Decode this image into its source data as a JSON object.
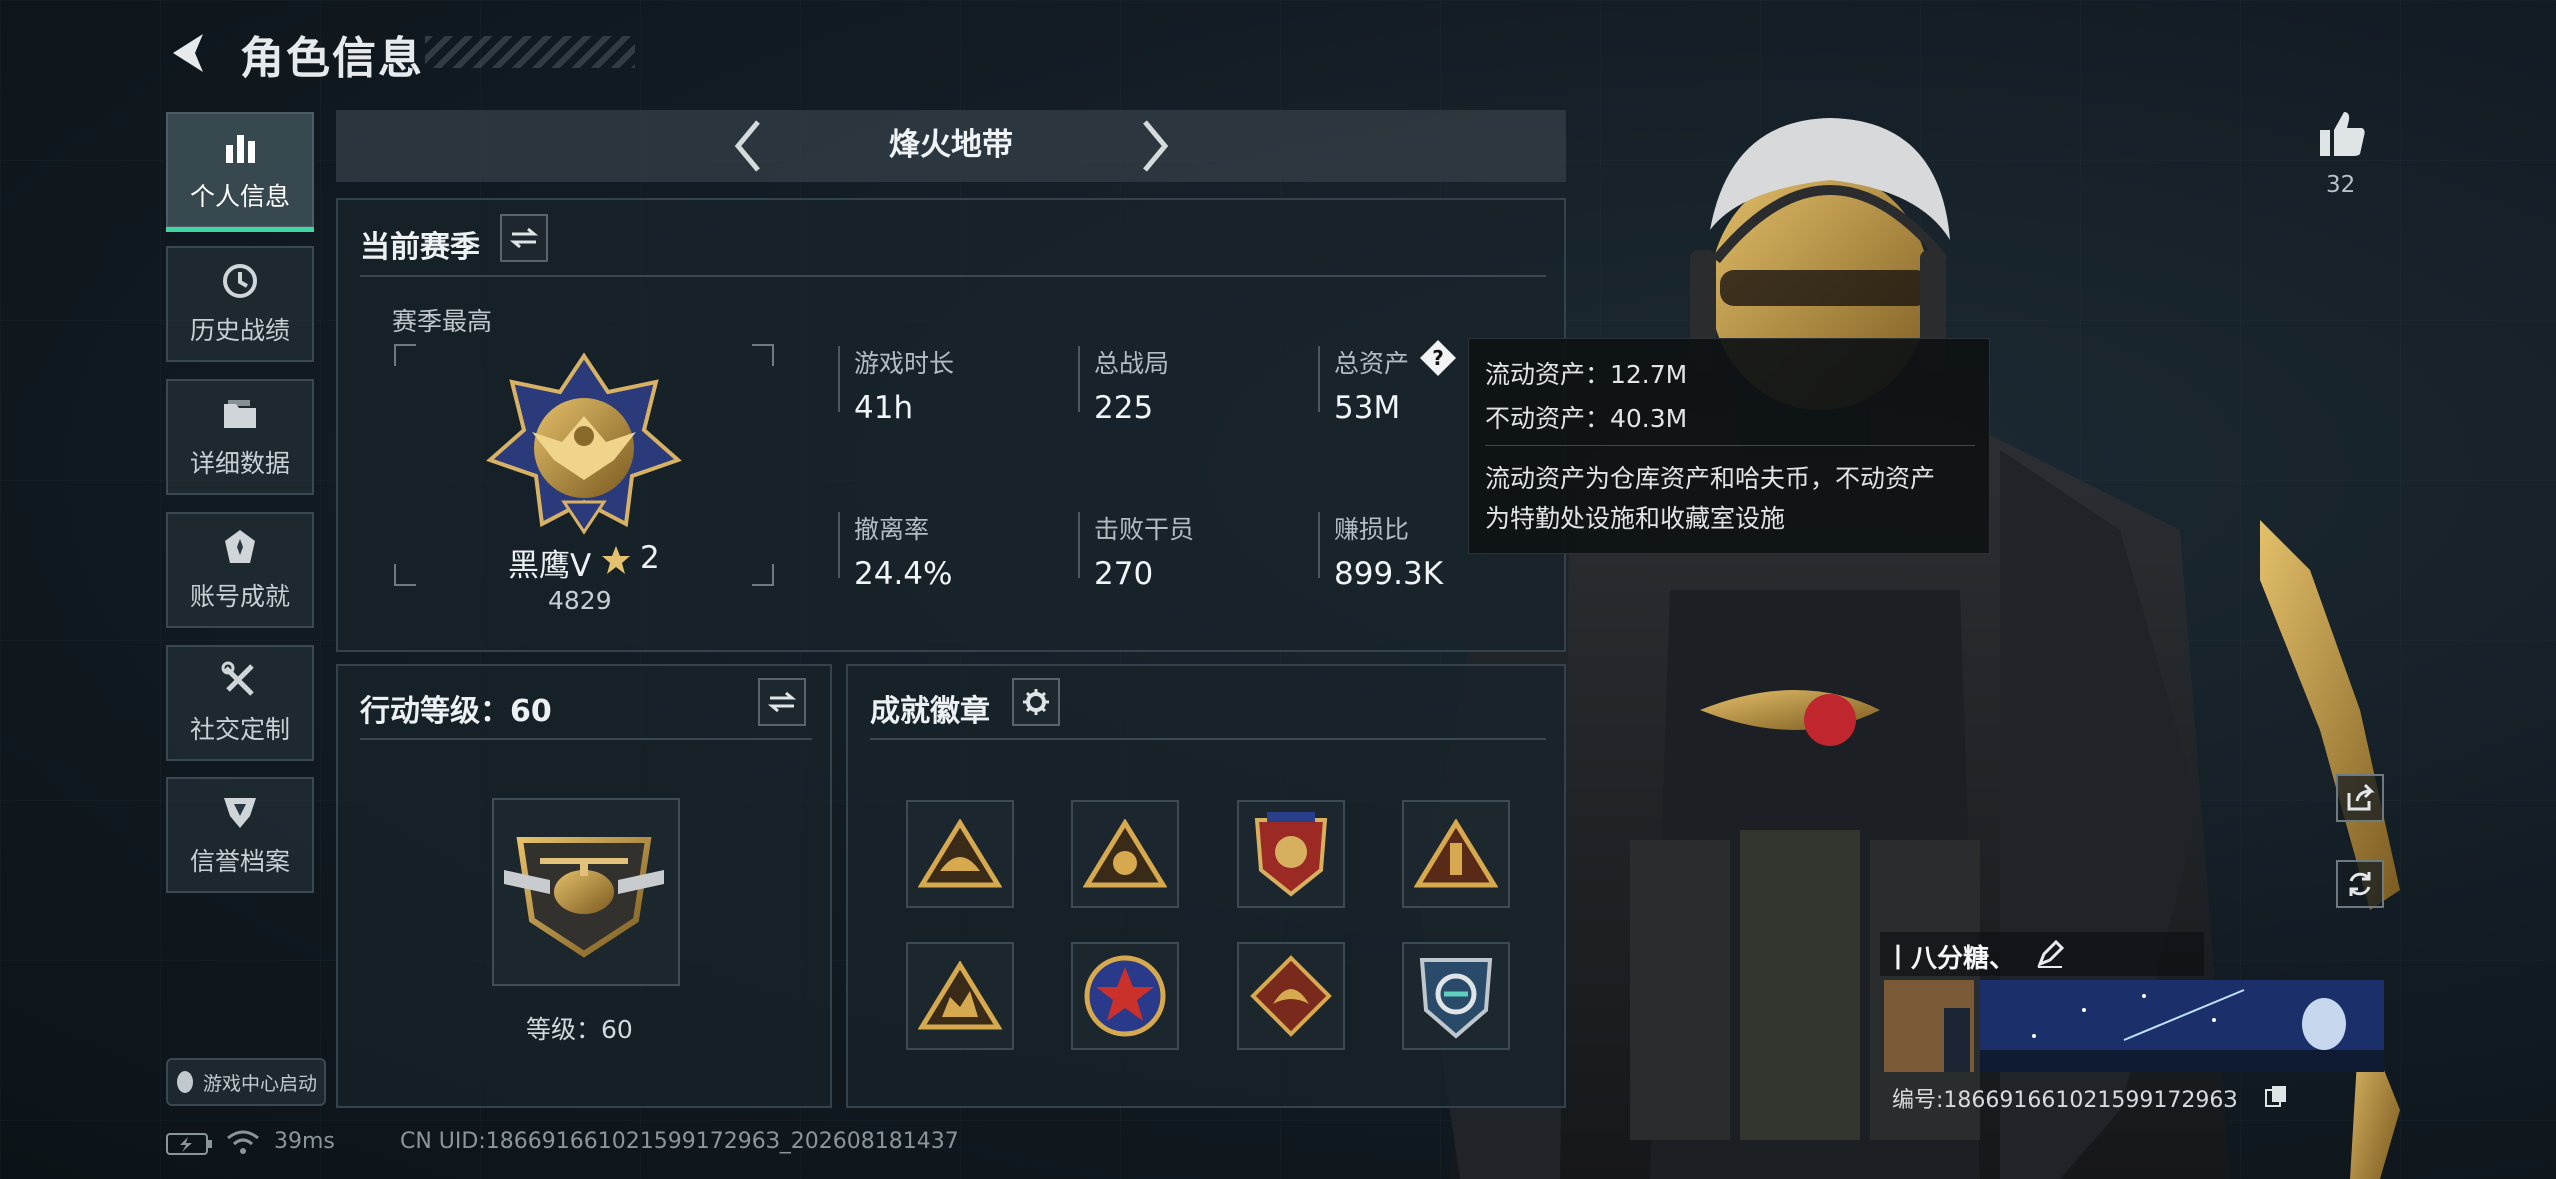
{
  "header": {
    "title": "角色信息"
  },
  "nav": {
    "items": [
      {
        "label": "个人信息",
        "icon": "bar-chart-icon",
        "active": true
      },
      {
        "label": "历史战绩",
        "icon": "clock-icon"
      },
      {
        "label": "详细数据",
        "icon": "folder-icon"
      },
      {
        "label": "账号成就",
        "icon": "achievement-icon"
      },
      {
        "label": "社交定制",
        "icon": "wrench-icon"
      },
      {
        "label": "信誉档案",
        "icon": "shield-icon"
      }
    ],
    "launch_label": "游戏中心启动"
  },
  "mode": {
    "name": "烽火地带"
  },
  "season": {
    "title": "当前赛季",
    "best_label": "赛季最高",
    "rank_name": "黑鹰Ⅴ",
    "rank_stars": "2",
    "rank_points": "4829",
    "stats": [
      {
        "label": "游戏时长",
        "value": "41h"
      },
      {
        "label": "总战局",
        "value": "225"
      },
      {
        "label": "总资产",
        "value": "53M"
      },
      {
        "label": "撤离率",
        "value": "24.4%"
      },
      {
        "label": "击败干员",
        "value": "270"
      },
      {
        "label": "赚损比",
        "value": "899.3K"
      }
    ]
  },
  "tooltip": {
    "liquid": "流动资产：12.7M",
    "fixed": "不动资产：40.3M",
    "desc_line1": "流动资产为仓库资产和哈夫币，不动资产",
    "desc_line2": "为特勤处设施和收藏室设施"
  },
  "action_level": {
    "title": "行动等级：60",
    "level_text": "等级：60"
  },
  "badges": {
    "title": "成就徽章",
    "items": [
      "badge-1",
      "badge-2",
      "badge-3",
      "badge-4",
      "badge-5",
      "badge-6",
      "badge-7",
      "badge-8"
    ]
  },
  "status": {
    "ping": "39ms",
    "uid": "CN UID:18669166102159917296З_202608181437"
  },
  "profile": {
    "likes": "32",
    "name": "丨八分糖、",
    "id": "编号:18669166102159917296З"
  },
  "colors": {
    "accent": "#3fd6a4",
    "panel": "#182229",
    "gold": "#c9a45a"
  }
}
